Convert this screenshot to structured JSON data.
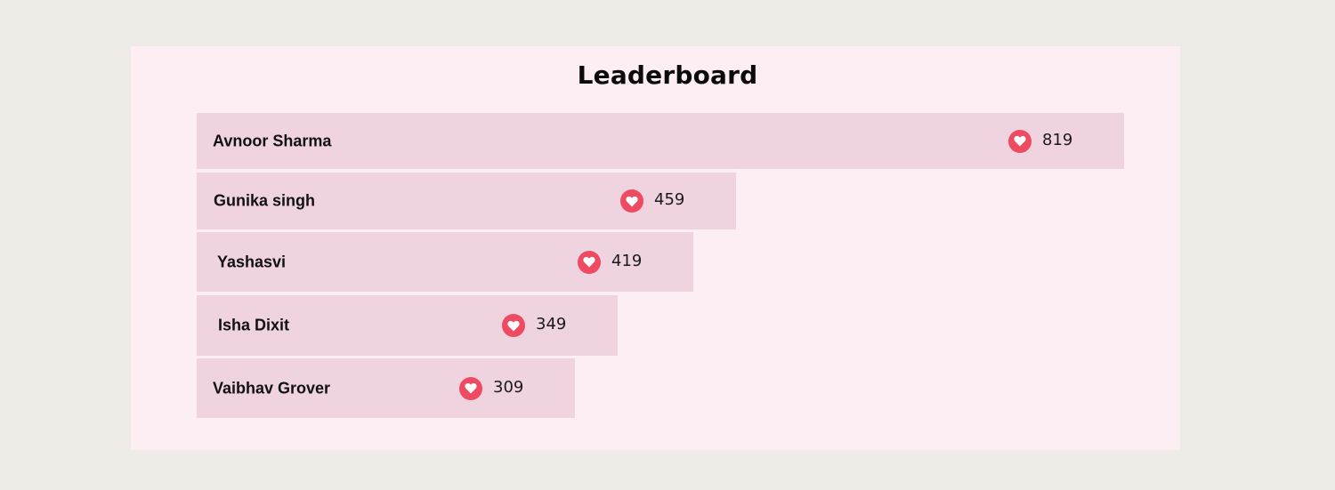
{
  "page": {
    "background": "#EEEAE6",
    "card_background": "#FDEEF4"
  },
  "chart_data": {
    "type": "bar",
    "orientation": "horizontal",
    "title": "Leaderboard",
    "icon": "heart-icon",
    "bar_color": "#EFD3DF",
    "icon_color": "#EE4A61",
    "categories": [
      "Avnoor Sharma",
      "Gunika singh",
      "Yashasvi",
      "Isha Dixit",
      "Vaibhav Grover"
    ],
    "values": [
      819,
      459,
      419,
      349,
      309
    ],
    "labels": [
      "819",
      "459",
      "419",
      "349",
      "309"
    ],
    "grid": false,
    "legend": "none"
  }
}
